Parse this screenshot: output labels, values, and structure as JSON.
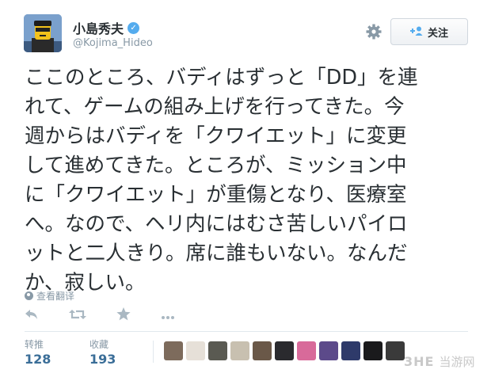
{
  "user": {
    "display_name": "小島秀夫",
    "handle": "@Kojima_Hideo",
    "verified_mark": "✓"
  },
  "header": {
    "follow_label": "关注",
    "follow_icon": "person-plus-icon",
    "settings_icon": "gear-icon"
  },
  "tweet": {
    "text": "ここのところ、バディはずっと「DD」を連\nれて、ゲームの組み上げを行ってきた。今\n週からはバディを「クワイエット」に変更\nして進めてきた。ところが、ミッション中\nに「クワイエット」が重傷となり、医療室\nへ。なので、ヘリ内にはむさ苦しいパイロ\nットと二人きり。席に誰もいない。なんだ\nか、寂しい。",
    "translate_label": "查看翻译"
  },
  "actions": {
    "reply_icon": "reply-icon",
    "retweet_icon": "retweet-icon",
    "favorite_icon": "star-icon",
    "more_icon": "more-icon"
  },
  "stats": {
    "retweets_label": "转推",
    "retweets_value": "128",
    "favorites_label": "收藏",
    "favorites_value": "193"
  },
  "favoriters": [
    {
      "color": "#7d6b5c"
    },
    {
      "color": "#e6e0d8"
    },
    {
      "color": "#5a5a52"
    },
    {
      "color": "#c8c0b0"
    },
    {
      "color": "#6a5848"
    },
    {
      "color": "#2a2a2e"
    },
    {
      "color": "#d86a9a"
    },
    {
      "color": "#5c4a8a"
    },
    {
      "color": "#2e3a6a"
    },
    {
      "color": "#1a1a1c"
    },
    {
      "color": "#3a3a3a"
    }
  ],
  "watermark": {
    "logo": "3HE",
    "text": "当游网"
  }
}
